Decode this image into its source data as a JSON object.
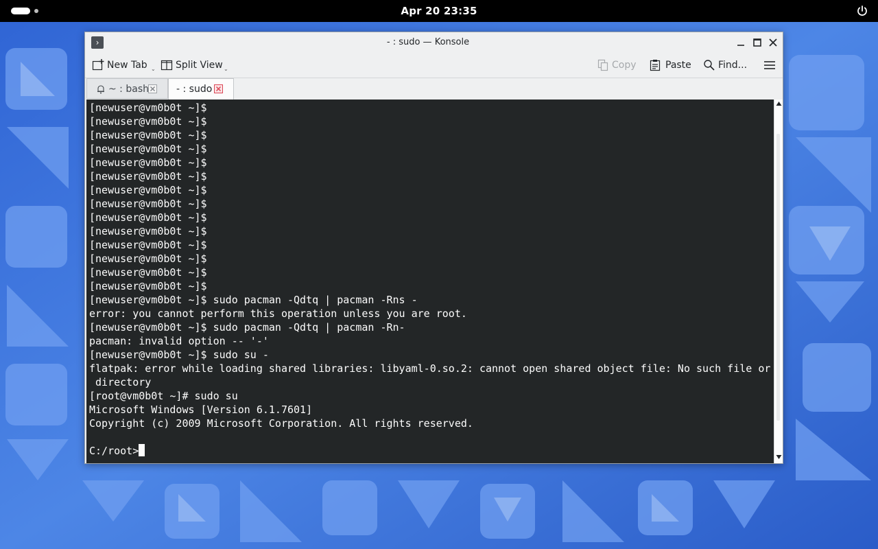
{
  "topbar": {
    "clock": "Apr 20  23:35"
  },
  "window": {
    "title": "- : sudo — Konsole"
  },
  "toolbar": {
    "new_tab": "New Tab",
    "split_view": "Split View",
    "copy": "Copy",
    "paste": "Paste",
    "find": "Find..."
  },
  "tabs": [
    {
      "label": "~ : bash"
    },
    {
      "label": "- : sudo"
    }
  ],
  "terminal": {
    "lines": [
      "[newuser@vm0b0t ~]$",
      "[newuser@vm0b0t ~]$",
      "[newuser@vm0b0t ~]$",
      "[newuser@vm0b0t ~]$",
      "[newuser@vm0b0t ~]$",
      "[newuser@vm0b0t ~]$",
      "[newuser@vm0b0t ~]$",
      "[newuser@vm0b0t ~]$",
      "[newuser@vm0b0t ~]$",
      "[newuser@vm0b0t ~]$",
      "[newuser@vm0b0t ~]$",
      "[newuser@vm0b0t ~]$",
      "[newuser@vm0b0t ~]$",
      "[newuser@vm0b0t ~]$",
      "[newuser@vm0b0t ~]$ sudo pacman -Qdtq | pacman -Rns -",
      "error: you cannot perform this operation unless you are root.",
      "[newuser@vm0b0t ~]$ sudo pacman -Qdtq | pacman -Rn-",
      "pacman: invalid option -- '-'",
      "[newuser@vm0b0t ~]$ sudo su -",
      "flatpak: error while loading shared libraries: libyaml-0.so.2: cannot open shared object file: No such file or",
      " directory",
      "[root@vm0b0t ~]# sudo su",
      "Microsoft Windows [Version 6.1.7601]",
      "Copyright (c) 2009 Microsoft Corporation. All rights reserved.",
      ""
    ],
    "prompt": "C:/root>"
  },
  "colors": {
    "terminal_bg": "#232627",
    "terminal_fg": "#fcfcfc",
    "wallpaper_base": "#3a6fd8",
    "tab_close_active": "#da4453"
  }
}
